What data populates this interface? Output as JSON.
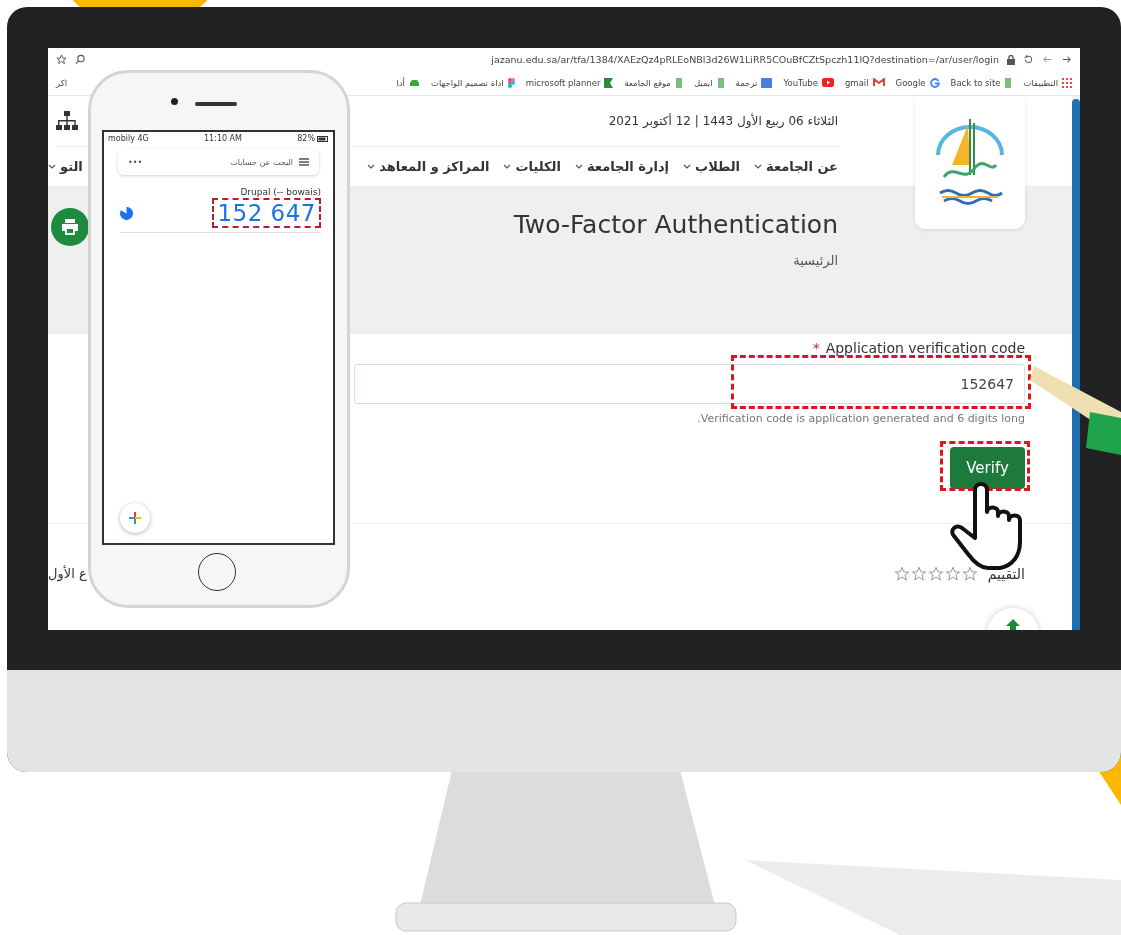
{
  "browser": {
    "url": "jazanu.edu.sa/ar/tfa/1384/XAEzQz4pRLEoNBl3d26W1LiRR5COuBfCZtSpczh11lQ?destination=/ar/user/login",
    "bookmarks": [
      {
        "label": "التطبيقات",
        "kind": "apps"
      },
      {
        "label": "Back to site",
        "kind": "page"
      },
      {
        "label": "Google",
        "kind": "google"
      },
      {
        "label": "gmail",
        "kind": "mail"
      },
      {
        "label": "YouTube",
        "kind": "video"
      },
      {
        "label": "ترجمة",
        "kind": "translate"
      },
      {
        "label": "ايميل",
        "kind": "page"
      },
      {
        "label": "موقع الجامعة",
        "kind": "page"
      },
      {
        "label": "microsoft planner",
        "kind": "planner"
      },
      {
        "label": "اداة تصميم الواجهات",
        "kind": "design"
      },
      {
        "label": "أدا",
        "kind": "car"
      },
      {
        "label": "اكر",
        "kind": "none"
      }
    ]
  },
  "header": {
    "date": "الثلاثاء 06 ربيع الأول 1443 | 12 أكتوبر 2021",
    "nav": [
      {
        "label": "عن الجامعة"
      },
      {
        "label": "الطلاب"
      },
      {
        "label": "إدارة الجامعة"
      },
      {
        "label": "الكليات"
      },
      {
        "label": "المراكز و المعاهد"
      },
      {
        "label": "التو"
      }
    ]
  },
  "page": {
    "title": "Two-Factor Authentication",
    "breadcrumb": "الرئيسية"
  },
  "form": {
    "required_mark": "*",
    "label": "Application verification code",
    "value": "152647",
    "hint": ".Verification code is application generated and 6 digits long",
    "button": "Verify"
  },
  "rating": {
    "label": "التقييم",
    "stars": 0,
    "side_text": "ع الأول"
  },
  "phone": {
    "carrier": "mobily 4G",
    "time": "11:10 AM",
    "battery": "82%",
    "search_placeholder": "البحث عن حسابات",
    "more": "•••",
    "account": "Drupal (-- bowais)",
    "code": "152 647"
  }
}
